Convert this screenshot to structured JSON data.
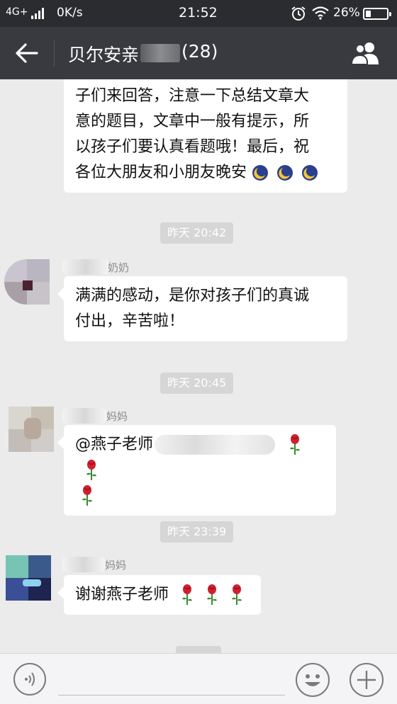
{
  "status_bar": {
    "network": "4G+",
    "speed": "0K/s",
    "time": "21:52",
    "battery": "26%",
    "battery_level": 0.26
  },
  "header": {
    "title": "贝尔安亲",
    "member_count": "(28)"
  },
  "messages": [
    {
      "lines": [
        "子们来回答，注意一下总结文章大",
        "意的题目，文章中一般有提示，所",
        "以孩子们要认真看题哦！最后，祝",
        "各位大朋友和小朋友晚安"
      ],
      "emoji": [
        "moon-emoji",
        "moon-emoji",
        "moon-emoji"
      ]
    },
    {
      "timestamp": "昨天 20:42",
      "nick_suffix": "奶奶",
      "lines": [
        "满满的感动，是你对孩子们的真诚",
        "付出，辛苦啦！"
      ]
    },
    {
      "timestamp": "昨天 20:45",
      "nick_suffix": "妈妈",
      "lines": [
        "@燕子老师"
      ],
      "emoji": [
        "rose-emoji",
        "rose-emoji",
        "rose-emoji"
      ]
    },
    {
      "timestamp": "昨天 23:39",
      "nick_suffix": "妈妈",
      "lines": [
        "谢谢燕子老师"
      ],
      "emoji": [
        "rose-emoji",
        "rose-emoji",
        "rose-emoji"
      ]
    }
  ],
  "input_bar": {
    "icons": [
      "voice-icon",
      "emoji-icon",
      "plus-icon"
    ]
  },
  "colors": {
    "status_bar": "#2b2c30",
    "title_bar": "#393a3f",
    "chat_bg": "#ebebeb",
    "bubble": "#ffffff",
    "timestamp_bg": "#d6d6d6"
  }
}
